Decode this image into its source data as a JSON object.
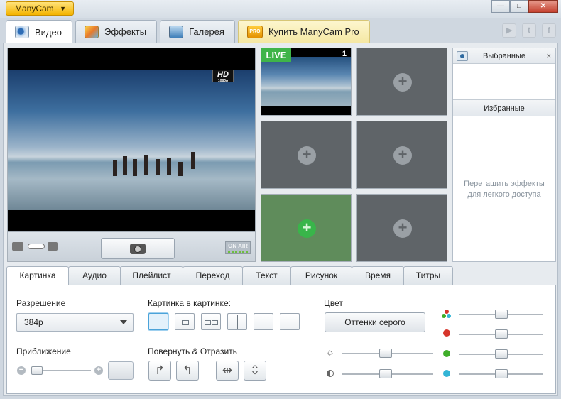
{
  "app": {
    "menu_label": "ManyCam"
  },
  "window_controls": {
    "minimize": "—",
    "maximize": "□",
    "close": "✕"
  },
  "main_tabs": [
    {
      "label": "Видео",
      "icon": "video-icon",
      "active": true
    },
    {
      "label": "Эффекты",
      "icon": "effects-icon"
    },
    {
      "label": "Галерея",
      "icon": "gallery-icon"
    },
    {
      "label": "Купить ManyCam Pro",
      "icon": "pro-icon",
      "icon_text": "PRO"
    }
  ],
  "social": {
    "youtube": "▶",
    "twitter": "t",
    "facebook": "f"
  },
  "preview": {
    "hd": "HD",
    "hd_sub": "1080p",
    "onair": "ON AIR"
  },
  "sources": {
    "live_badge": "LIVE",
    "live_number": "1",
    "add": "+"
  },
  "panel": {
    "selected_title": "Выбранные",
    "close": "×",
    "favorites_title": "Избранные",
    "hint_line1": "Перетащить эффекты",
    "hint_line2": "для легкого доступа"
  },
  "sub_tabs": [
    "Картинка",
    "Аудио",
    "Плейлист",
    "Переход",
    "Текст",
    "Рисунок",
    "Время",
    "Титры"
  ],
  "picture": {
    "resolution_label": "Разрешение",
    "resolution_value": "384p",
    "zoom_label": "Приближение",
    "zoom_minus": "−",
    "zoom_plus": "+",
    "pip_label": "Картинка в картинке:",
    "rotate_label": "Повернуть & Отразить",
    "color_label": "Цвет",
    "grayscale_button": "Оттенки серого"
  },
  "colors": {
    "accent": "#f4b400",
    "live": "#3fb449",
    "red": "#d6352b",
    "green": "#3fae2a",
    "cyan": "#33b5d6"
  }
}
